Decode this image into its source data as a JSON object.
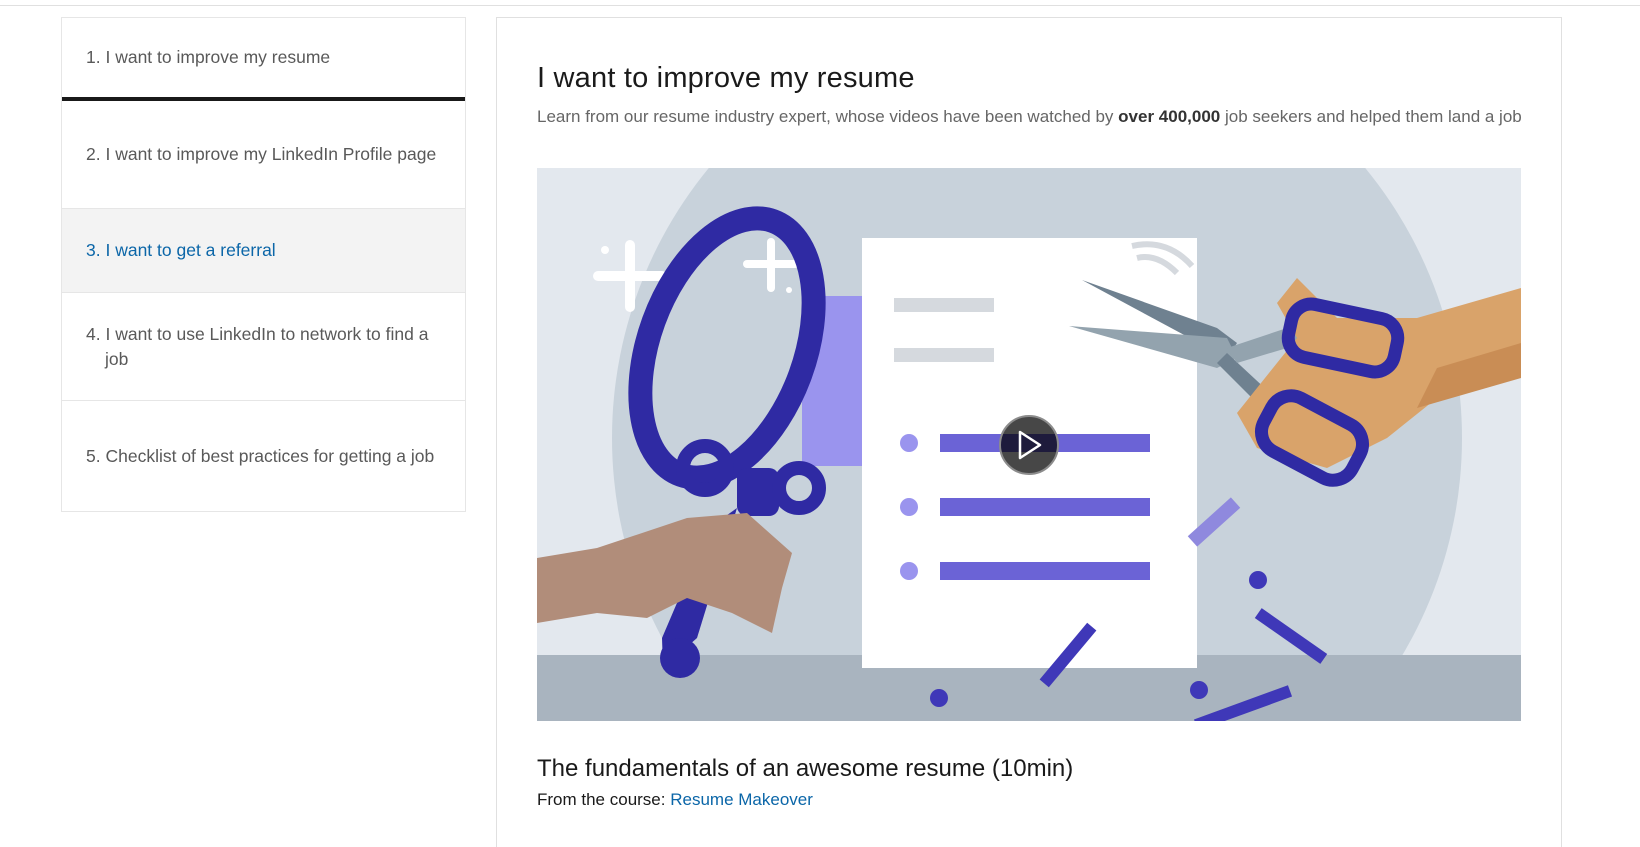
{
  "sidebar": {
    "items": [
      {
        "number": "1.",
        "label": "I want to improve my resume",
        "state": "active"
      },
      {
        "number": "2.",
        "label": "I want to improve my LinkedIn Profile page",
        "state": "default"
      },
      {
        "number": "3.",
        "label": "I want to get a referral",
        "state": "hover"
      },
      {
        "number": "4.",
        "label": "I want to use LinkedIn to network to find a job",
        "state": "default"
      },
      {
        "number": "5.",
        "label": "Checklist of best practices for getting a job",
        "state": "default"
      }
    ]
  },
  "main": {
    "title": "I want to improve my resume",
    "description": {
      "before": "Learn from our resume industry expert, whose videos have been watched by ",
      "bold": "over 400,000",
      "after": " job seekers and helped them land a job"
    },
    "video": {
      "play_icon": "play-icon"
    },
    "lesson": {
      "title": "The fundamentals of an awesome resume (10min)",
      "course_prefix": "From the course:",
      "course_link": "Resume Makeover"
    }
  },
  "colors": {
    "link": "#0b66a8",
    "active_underline": "#191919",
    "accent_purple": "#6b63d6"
  }
}
